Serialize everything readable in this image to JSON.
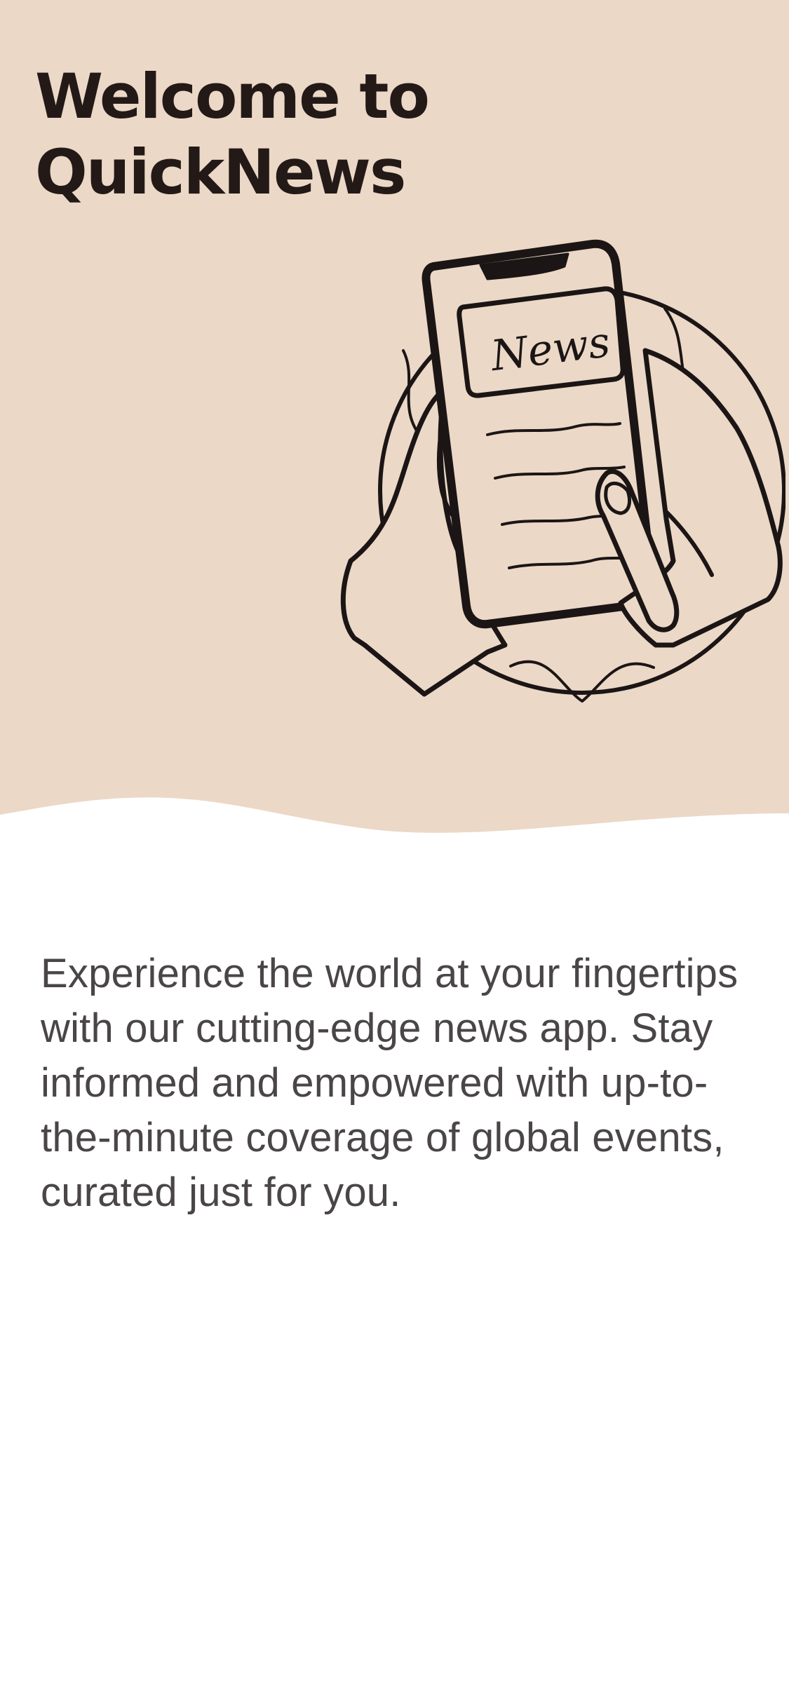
{
  "hero": {
    "title_line1": "Welcome to",
    "title_line2": "QuickNews",
    "illustration_label": "News",
    "background_color": "#ecd8c7"
  },
  "body": {
    "description": "Experience the world at your fingertips with our cutting-edge news app. Stay informed and empowered with up-to-the-minute coverage of global events, curated just for you."
  },
  "colors": {
    "title": "#231a17",
    "text": "#4a4546",
    "page_background": "#ffffff"
  }
}
